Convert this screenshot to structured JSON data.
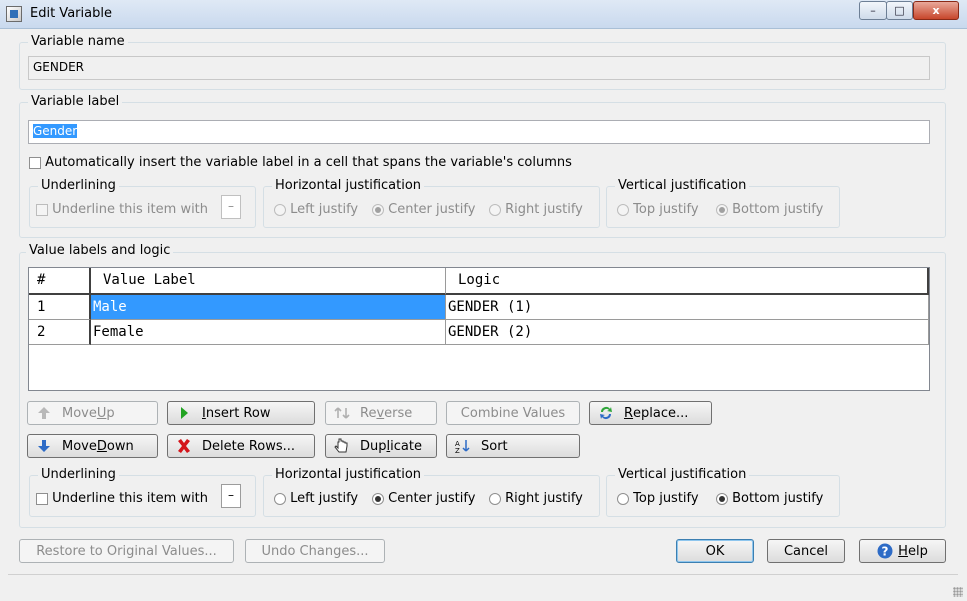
{
  "window": {
    "title": "Edit Variable",
    "controls": {
      "minimize": "–",
      "maximize": "□",
      "close": "x"
    }
  },
  "variable_name": {
    "label": "Variable name",
    "value": "GENDER"
  },
  "variable_label": {
    "label": "Variable label",
    "value": "Gender",
    "auto_insert_label": "Automatically insert the variable label in a cell that spans the variable's columns",
    "auto_insert_checked": false,
    "underlining": {
      "label": "Underlining",
      "checkbox_label": "Underline this item with",
      "char": "–"
    },
    "horizontal": {
      "label": "Horizontal justification",
      "options": [
        "Left justify",
        "Center justify",
        "Right justify"
      ],
      "selected": "Center justify"
    },
    "vertical": {
      "label": "Vertical justification",
      "options": [
        "Top justify",
        "Bottom justify"
      ],
      "selected": "Bottom justify"
    }
  },
  "value_labels": {
    "label": "Value labels and logic",
    "columns": [
      "#",
      "Value Label",
      "Logic"
    ],
    "rows": [
      {
        "num": "1",
        "label": "Male",
        "logic": "GENDER (1)"
      },
      {
        "num": "2",
        "label": "Female",
        "logic": "GENDER (2)"
      }
    ],
    "buttons": {
      "move_up": {
        "pre": "Move ",
        "key": "U",
        "post": "p"
      },
      "insert_row": {
        "pre": "",
        "key": "I",
        "post": "nsert Row"
      },
      "reverse": {
        "pre": "Re",
        "key": "v",
        "post": "erse"
      },
      "combine_values": "Combine Values",
      "replace": {
        "pre": "",
        "key": "R",
        "post": "eplace..."
      },
      "move_down": {
        "pre": "Move ",
        "key": "D",
        "post": "own"
      },
      "delete_rows": "Delete Rows...",
      "duplicate": {
        "pre": "Dup",
        "key": "l",
        "post": "icate"
      },
      "sort": "Sort"
    },
    "underlining": {
      "label": "Underlining",
      "checkbox_label": "Underline this item with",
      "char": "–"
    },
    "horizontal": {
      "label": "Horizontal justification",
      "options": [
        "Left justify",
        "Center justify",
        "Right justify"
      ],
      "selected": "Center justify"
    },
    "vertical": {
      "label": "Vertical justification",
      "options": [
        "Top justify",
        "Bottom justify"
      ],
      "selected": "Bottom justify"
    }
  },
  "footer": {
    "restore": "Restore to Original Values...",
    "undo": "Undo Changes...",
    "ok": "OK",
    "cancel": "Cancel",
    "help": {
      "pre": "",
      "key": "H",
      "post": "elp"
    }
  },
  "colors": {
    "selection": "#3399ff",
    "disabled_text": "#8c8c8c",
    "insert_icon": "#22a322",
    "delete_icon": "#d4141a",
    "down_arrow": "#2d6bc6"
  }
}
